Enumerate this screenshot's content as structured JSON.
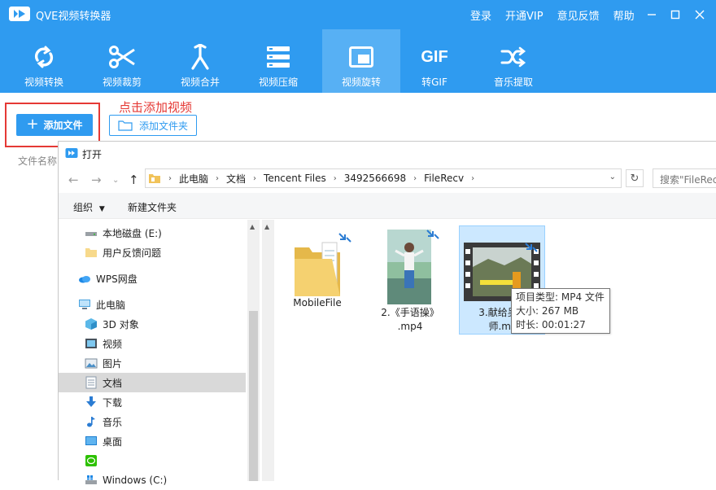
{
  "app": {
    "title": "QVE视频转换器",
    "links": [
      "登录",
      "开通VIP",
      "意见反馈",
      "帮助"
    ],
    "colors": {
      "primary": "#2f9bf0",
      "active_tab": "#57b0f4",
      "highlight_red": "#e53935"
    }
  },
  "toolbar": {
    "items": [
      {
        "label": "视频转换",
        "icon": "refresh-icon"
      },
      {
        "label": "视频裁剪",
        "icon": "scissors-icon"
      },
      {
        "label": "视频合并",
        "icon": "merge-icon"
      },
      {
        "label": "视频压缩",
        "icon": "compress-icon"
      },
      {
        "label": "视频旋转",
        "icon": "rotate-screen-icon",
        "active": true
      },
      {
        "label": "转GIF",
        "icon": "gif-icon"
      },
      {
        "label": "音乐提取",
        "icon": "shuffle-icon"
      }
    ],
    "gif_text": "GIF"
  },
  "actions": {
    "add_file": "添加文件",
    "add_folder": "添加文件夹",
    "hint": "点击添加视频",
    "column_file_name": "文件名称"
  },
  "dialog": {
    "title": "打开",
    "breadcrumb": [
      "此电脑",
      "文档",
      "Tencent Files",
      "3492566698",
      "FileRecv"
    ],
    "search_placeholder": "搜索\"FileRecv\"",
    "commands": {
      "organize": "组织",
      "new_folder": "新建文件夹"
    },
    "nav_items": [
      {
        "label": "本地磁盘 (E:)",
        "icon": "drive-icon"
      },
      {
        "label": "用户反馈问题",
        "icon": "folder-icon"
      },
      {
        "label": "WPS网盘",
        "icon": "cloud-icon"
      },
      {
        "label": "此电脑",
        "icon": "computer-icon"
      },
      {
        "label": "3D 对象",
        "icon": "cube-3d-icon"
      },
      {
        "label": "视频",
        "icon": "video-folder-icon"
      },
      {
        "label": "图片",
        "icon": "picture-folder-icon"
      },
      {
        "label": "文档",
        "icon": "document-folder-icon",
        "selected": true
      },
      {
        "label": "下载",
        "icon": "download-icon"
      },
      {
        "label": "音乐",
        "icon": "music-icon"
      },
      {
        "label": "桌面",
        "icon": "desktop-icon"
      },
      {
        "label": "",
        "icon": "wechat-icon"
      },
      {
        "label": "Windows (C:)",
        "icon": "windows-drive-icon"
      }
    ],
    "files": [
      {
        "name_line1": "MobileFile",
        "name_line2": "",
        "type": "folder"
      },
      {
        "name_line1": "2.《手语操》",
        "name_line2": ".mp4",
        "type": "video"
      },
      {
        "name_line1": "3.献给吴王",
        "name_line2": "师.mp",
        "type": "video",
        "selected": true
      }
    ],
    "tooltip": {
      "type_line": "项目类型: MP4 文件",
      "size_line": "大小: 267 MB",
      "duration_line": "时长: 00:01:27"
    }
  }
}
